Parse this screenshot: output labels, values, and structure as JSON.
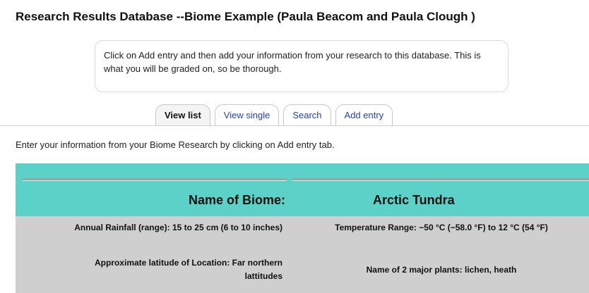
{
  "page": {
    "title": "Research Results Database --Biome Example (Paula Beacom and Paula Clough )"
  },
  "intro": {
    "text": "Click on Add entry and then add your information from your research to this database.  This is what you will be graded on, so be thorough."
  },
  "tabs": [
    {
      "label": "View list",
      "active": true
    },
    {
      "label": "View single",
      "active": false
    },
    {
      "label": "Search",
      "active": false
    },
    {
      "label": "Add entry",
      "active": false
    }
  ],
  "instruction": "Enter your information from your Biome Research by clicking on Add entry tab.",
  "entry": {
    "header": {
      "label": "Name of Biome:",
      "value": "Arctic Tundra"
    },
    "rainfall": "Annual Rainfall (range):  15 to 25 cm (6 to 10 inches)",
    "temperature": "Temperature Range:  −50 °C (−58.0 °F) to 12 °C (54 °F)",
    "latitude": "Approximate latitude of Location:  Far northern lattitudes",
    "plants": "Name of 2 major plants:  lichen, heath"
  },
  "colors": {
    "header_band": "#5bd1c7",
    "row_background": "#cfcfcf",
    "link_blue": "#1f3fd0"
  }
}
